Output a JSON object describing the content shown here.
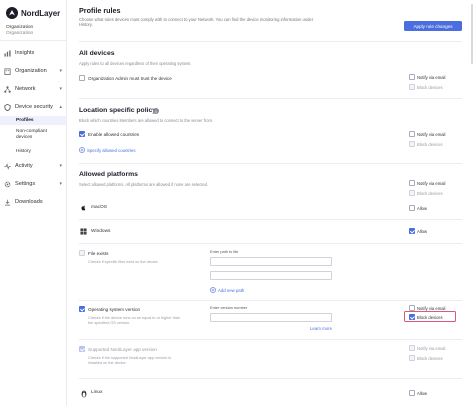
{
  "app": {
    "brand": "NordLayer"
  },
  "organization": {
    "name": "Organization",
    "sub": "Organization"
  },
  "sidebar": {
    "items": [
      {
        "label": "Insights",
        "icon": "chart-icon"
      },
      {
        "label": "Organization",
        "icon": "building-icon"
      },
      {
        "label": "Network",
        "icon": "network-icon"
      },
      {
        "label": "Device security",
        "icon": "shield-icon"
      },
      {
        "label": "Activity",
        "icon": "activity-icon"
      },
      {
        "label": "Settings",
        "icon": "gear-icon"
      },
      {
        "label": "Downloads",
        "icon": "download-icon"
      }
    ],
    "sub_items": [
      {
        "label": "Profiles"
      },
      {
        "label": "Non-compliant"
      },
      {
        "label": "devices"
      },
      {
        "label": "History"
      }
    ]
  },
  "header": {
    "title": "Profile rules",
    "desc_line1": "Choose what rules devices must comply with to connect to your Network. You can find the device monitoring information under",
    "desc_line2": "History.",
    "apply_label": "Apply rule changes"
  },
  "all_devices": {
    "title": "All devices",
    "desc": "Apply rules to all devices regardless of their operating system.",
    "rule_label": "Organization Admin must trust the device",
    "notify": "Notify via email",
    "block": "Block devices"
  },
  "location": {
    "title": "Location specific policy",
    "desc": "Block which countries Members are allowed to connect to the server from.",
    "rule_label": "Enable allowed countries",
    "add_link": "Specify allowed countries",
    "notify": "Notify via email",
    "block": "Block devices"
  },
  "platforms": {
    "title": "Allowed platforms",
    "desc": "Select allowed platforms. All platforms are allowed if none are selected.",
    "notify": "Notify via email",
    "block": "Block devices",
    "allow": "Allow",
    "macos": "macOS",
    "windows": "Windows",
    "linux": "Linux"
  },
  "windows_rules": {
    "file_exists": {
      "label": "File exists",
      "desc": "Checks if specific files exist on the device.",
      "field_label": "Enter path to file",
      "add_link": "Add new path"
    },
    "os_version": {
      "label": "Operating system version",
      "desc_line1": "Checks if the device runs on an equal to or higher than",
      "desc_line2": "the specified OS version.",
      "field_label": "Enter version number",
      "learn_more": "Learn more",
      "notify": "Notify via email",
      "block": "Block devices"
    },
    "app_version": {
      "label": "Supported NordLayer app version",
      "desc_line1": "Checks if the supported NordLayer app version is",
      "desc_line2": "installed on the device.",
      "notify": "Notify via email",
      "block": "Block devices"
    }
  },
  "colors": {
    "accent": "#4a6ee0",
    "highlight": "#e0577b"
  }
}
